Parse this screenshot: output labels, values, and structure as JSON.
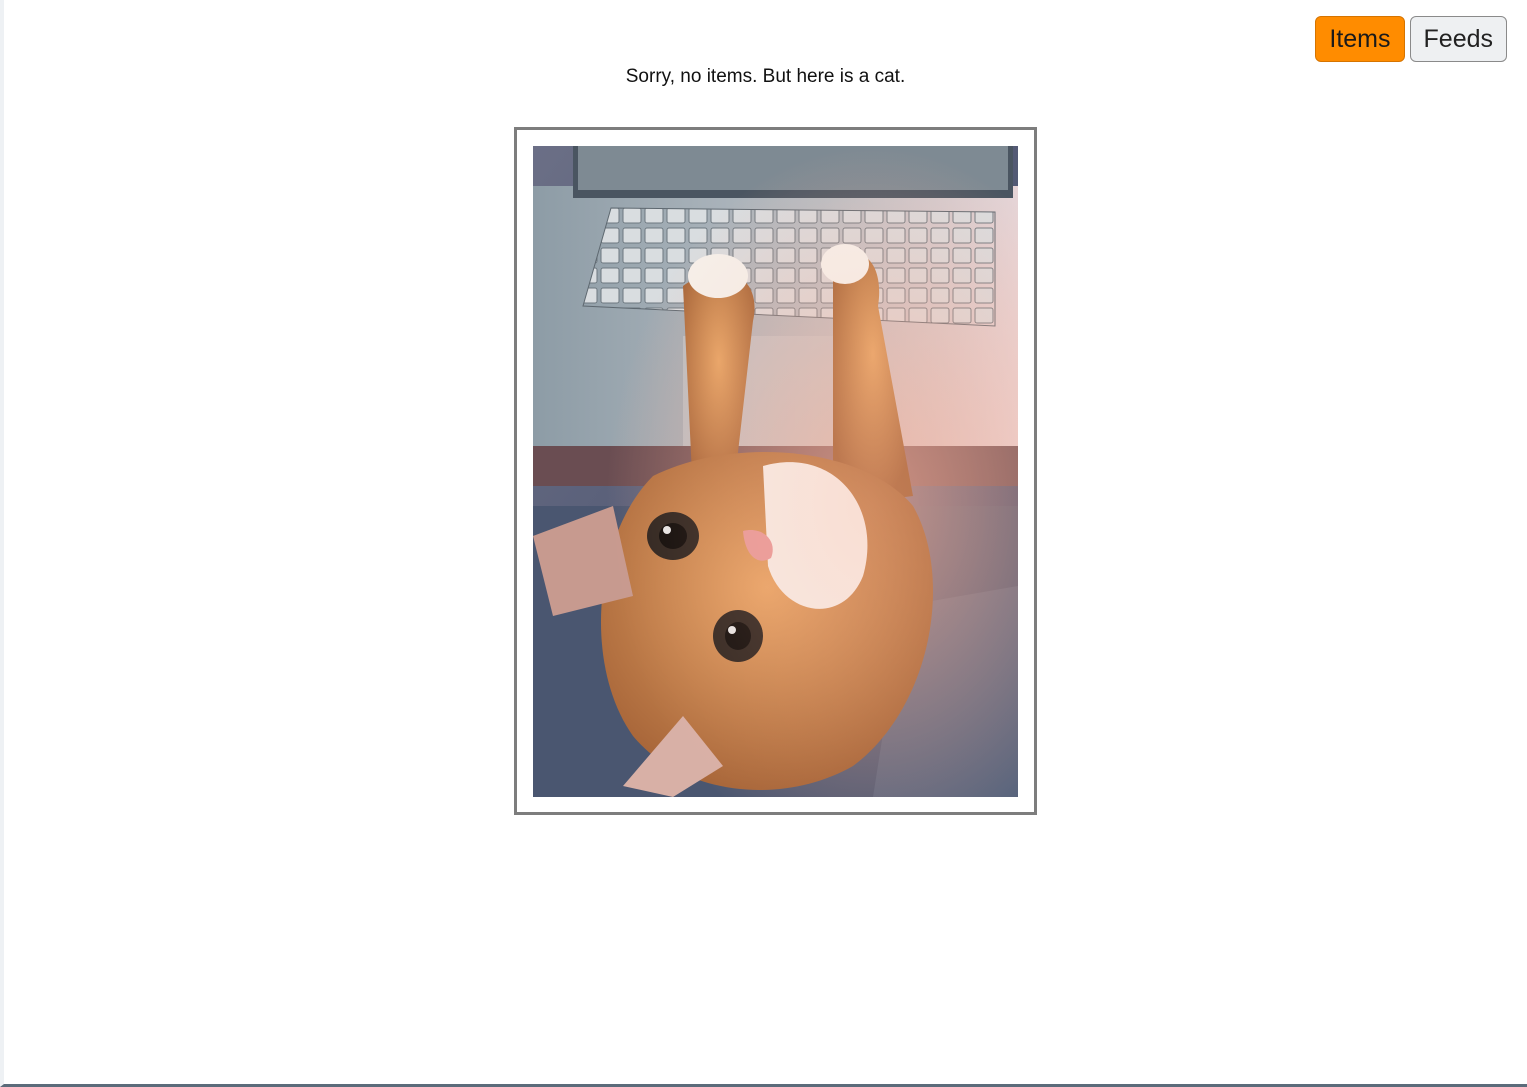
{
  "nav": {
    "items_label": "Items",
    "feeds_label": "Feeds",
    "active": "Items",
    "accent_color": "#ff8c00"
  },
  "empty_state": {
    "message": "Sorry, no items. But here is a cat.",
    "image": "cat-photo"
  }
}
